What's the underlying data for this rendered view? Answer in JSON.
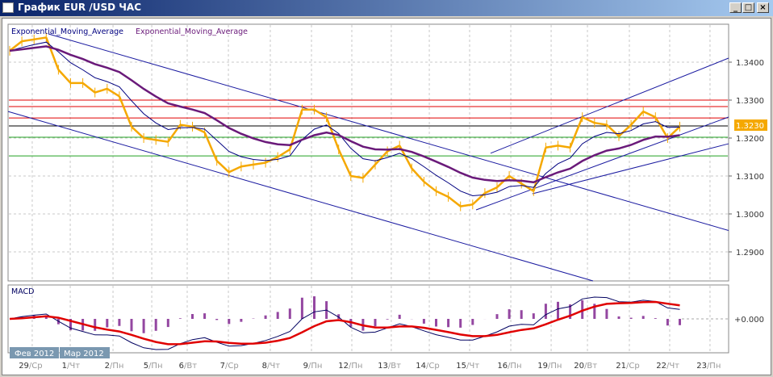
{
  "window": {
    "title": "График EUR /USD ЧАС",
    "buttons": [
      "_",
      "□",
      "×"
    ]
  },
  "legend": {
    "ema_fast": "Exponential_Moving_Average",
    "ema_slow": "Exponential_Moving_Average"
  },
  "macd_panel": {
    "title": "MACD",
    "zero_label": "+0.000"
  },
  "months": [
    "Фев 2012",
    "Мар 2012"
  ],
  "colors": {
    "price": "#f5a800",
    "ema_fast": "#000080",
    "ema_slow": "#6a1a7a",
    "macd": "#000060",
    "signal": "#e00000",
    "hist": "#7a1a8a",
    "resistance": "#e00000",
    "support": "#20a020",
    "current": "#000000",
    "trend": "#1a1aa0",
    "price_tag": "#f5a800"
  },
  "chart_data": {
    "type": "line",
    "title": "EUR/USD H1",
    "ylim": [
      1.282,
      1.3505
    ],
    "y_ticks": [
      "1.3400",
      "1.3300",
      "1.3200",
      "1.3100",
      "1.3000",
      "1.2900"
    ],
    "current_price": "1.3230",
    "x_ticks": [
      {
        "d": "29",
        "w": "Ср",
        "i": 1.85
      },
      {
        "d": "1",
        "w": "Чт",
        "i": 4.97
      },
      {
        "d": "2",
        "w": "Пн",
        "i": 8.48
      },
      {
        "d": "5",
        "w": "Пн",
        "i": 11.66
      },
      {
        "d": "6",
        "w": "Вт",
        "i": 14.57
      },
      {
        "d": "7",
        "w": "Ср",
        "i": 17.95
      },
      {
        "d": "8",
        "w": "Чт",
        "i": 21.39
      },
      {
        "d": "9",
        "w": "Пн",
        "i": 24.77
      },
      {
        "d": "12",
        "w": "Пн",
        "i": 28.08
      },
      {
        "d": "13",
        "w": "Вт",
        "i": 31.32
      },
      {
        "d": "14",
        "w": "Ср",
        "i": 34.44
      },
      {
        "d": "15",
        "w": "Чт",
        "i": 37.75
      },
      {
        "d": "16",
        "w": "Пн",
        "i": 41.13
      },
      {
        "d": "19",
        "w": "Пн",
        "i": 44.44
      },
      {
        "d": "20",
        "w": "Вт",
        "i": 47.42
      },
      {
        "d": "21",
        "w": "Ср",
        "i": 50.86
      },
      {
        "d": "22",
        "w": "Чт",
        "i": 54.17
      },
      {
        "d": "23",
        "w": "Пн",
        "i": 57.48
      }
    ],
    "price": [
      1.343,
      1.3455,
      1.346,
      1.3465,
      1.338,
      1.3345,
      1.3345,
      1.332,
      1.333,
      1.331,
      1.323,
      1.32,
      1.3195,
      1.319,
      1.3235,
      1.323,
      1.3215,
      1.314,
      1.311,
      1.3125,
      1.313,
      1.3135,
      1.315,
      1.317,
      1.3275,
      1.3275,
      1.3255,
      1.317,
      1.31,
      1.3095,
      1.313,
      1.3165,
      1.318,
      1.312,
      1.3085,
      1.306,
      1.3045,
      1.302,
      1.3025,
      1.3055,
      1.307,
      1.31,
      1.308,
      1.306,
      1.3175,
      1.318,
      1.3175,
      1.3255,
      1.324,
      1.3235,
      1.3205,
      1.3235,
      1.327,
      1.3255,
      1.32,
      1.323
    ],
    "hlines": [
      {
        "price": 1.33,
        "kind": "resistance"
      },
      {
        "price": 1.3283,
        "kind": "resistance"
      },
      {
        "price": 1.3253,
        "kind": "resistance"
      },
      {
        "price": 1.3232,
        "kind": "current"
      },
      {
        "price": 1.3202,
        "kind": "support"
      },
      {
        "price": 1.3153,
        "kind": "support"
      }
    ],
    "trendlines": [
      [
        [
          3.18,
          1.34745
        ],
        [
          59,
          1.29564
        ]
      ],
      [
        [
          -0.13,
          1.327
        ],
        [
          47.88,
          1.28234
        ]
      ],
      [
        [
          39.47,
          1.316
        ],
        [
          59,
          1.34106
        ]
      ],
      [
        [
          38.28,
          1.30106
        ],
        [
          59,
          1.32553
        ]
      ],
      [
        [
          42.9,
          1.30532
        ],
        [
          59,
          1.3185
        ]
      ]
    ]
  }
}
